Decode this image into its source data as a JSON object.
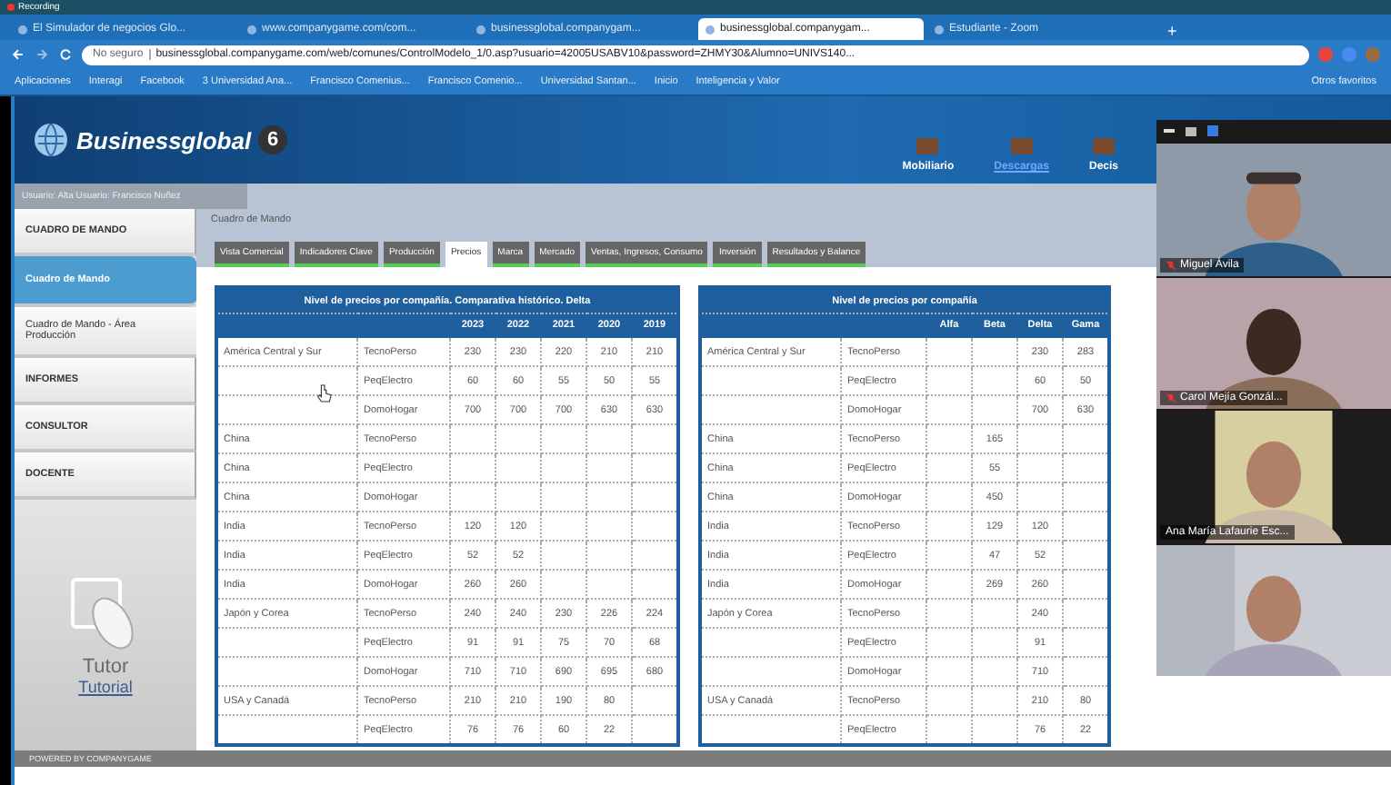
{
  "recording": {
    "label": "Recording"
  },
  "browser": {
    "tabs": [
      {
        "title": "El Simulador de negocios Glo...",
        "selected": false
      },
      {
        "title": "www.companygame.com/com...",
        "selected": false
      },
      {
        "title": "businessglobal.companygam...",
        "selected": false
      },
      {
        "title": "businessglobal.companygam...",
        "selected": true
      },
      {
        "title": "Estudiante - Zoom",
        "selected": false
      }
    ],
    "new_tab": "+",
    "address": {
      "security": "No seguro",
      "url": "businessglobal.companygame.com/web/comunes/ControlModelo_1/0.asp?usuario=42005USABV10&password=ZHMY30&Alumno=UNIVS140..."
    },
    "bookmarks": [
      "Aplicaciones",
      "Interagi",
      "Facebook",
      "3 Universidad Ana...",
      "Francisco Comenius...",
      "Francisco Comenio...",
      "Universidad Santan...",
      "Inicio",
      "Inteligencia y Valor"
    ],
    "other_bookmarks": "Otros favoritos"
  },
  "site": {
    "logo": "Businessglobal",
    "edition": "6",
    "nav": [
      {
        "label": "Mobiliario",
        "selected": false
      },
      {
        "label": "Descargas",
        "selected": true
      },
      {
        "label": "Decis",
        "selected": false
      }
    ],
    "user_strip": "Usuario: Alta  Usuario: Francisco Nuñez",
    "sidebar": {
      "items": [
        {
          "label": "CUADRO DE MANDO",
          "kind": "section",
          "selected": false
        },
        {
          "label": "Cuadro de Mando",
          "kind": "sub",
          "selected": true
        },
        {
          "label": "Cuadro de Mando - Área Producción",
          "kind": "sub",
          "selected": false
        },
        {
          "label": "INFORMES",
          "kind": "section",
          "selected": false
        },
        {
          "label": "CONSULTOR",
          "kind": "section",
          "selected": false
        },
        {
          "label": "DOCENTE",
          "kind": "section",
          "selected": false
        }
      ],
      "tutor": {
        "title": "Tutor",
        "link": "Tutorial"
      }
    },
    "breadcrumb": "Cuadro de Mando",
    "tabs": [
      {
        "label": "Vista Comercial",
        "selected": false
      },
      {
        "label": "Indicadores Clave",
        "selected": false
      },
      {
        "label": "Producción",
        "selected": false
      },
      {
        "label": "Precios",
        "selected": true
      },
      {
        "label": "Marca",
        "selected": false
      },
      {
        "label": "Mercado",
        "selected": false
      },
      {
        "label": "Ventas, Ingresos, Consumo",
        "selected": false
      },
      {
        "label": "Inversión",
        "selected": false
      },
      {
        "label": "Resultados y Balance",
        "selected": false
      }
    ],
    "tables": [
      {
        "title": "Nivel de precios por compañía. Comparativa histórico. Delta",
        "columns": [
          "2023",
          "2022",
          "2021",
          "2020",
          "2019"
        ],
        "rows": [
          {
            "region": "América Central y Sur",
            "company": "TecnoPerso",
            "cells": [
              {
                "text": "230"
              },
              {
                "text": "230"
              },
              {
                "text": "220"
              },
              {
                "text": "210"
              },
              {
                "text": "210"
              }
            ]
          },
          {
            "company": "PeqElectro",
            "cells": [
              {
                "text": "60"
              },
              {
                "text": "60"
              },
              {
                "text": "55"
              },
              {
                "text": "50"
              },
              {
                "text": "55"
              }
            ]
          },
          {
            "company": "DomoHogar",
            "cells": [
              {
                "text": "700"
              },
              {
                "text": "700"
              },
              {
                "text": "700"
              },
              {
                "text": "630"
              },
              {
                "text": "630"
              }
            ]
          },
          {
            "region": "China",
            "company": "TecnoPerso",
            "cells": [
              {
                "blank": true
              },
              {
                "blank": true
              },
              {
                "blank": true
              },
              {
                "blank": true
              },
              {
                "blank": true
              }
            ]
          },
          {
            "region": "China",
            "company": "PeqElectro",
            "cells": [
              {
                "blank": true
              },
              {
                "blank": true
              },
              {
                "blank": true
              },
              {
                "blank": true
              },
              {
                "blank": true
              }
            ]
          },
          {
            "region": "China",
            "company": "DomoHogar",
            "cells": [
              {
                "blank": true
              },
              {
                "blank": true
              },
              {
                "blank": true
              },
              {
                "blank": true
              },
              {
                "blank": true
              }
            ]
          },
          {
            "region": "India",
            "company": "TecnoPerso",
            "cells": [
              {
                "text": "120"
              },
              {
                "text": "120"
              },
              {
                "blank": true
              },
              {
                "blank": true
              },
              {
                "blank": true
              }
            ]
          },
          {
            "region": "India",
            "company": "PeqElectro",
            "cells": [
              {
                "text": "52"
              },
              {
                "text": "52"
              },
              {
                "blank": true
              },
              {
                "blank": true
              },
              {
                "blank": true
              }
            ]
          },
          {
            "region": "India",
            "company": "DomoHogar",
            "cells": [
              {
                "text": "260"
              },
              {
                "text": "260"
              },
              {
                "blank": true
              },
              {
                "blank": true
              },
              {
                "blank": true
              }
            ]
          },
          {
            "region": "Japón y Corea",
            "company": "TecnoPerso",
            "cells": [
              {
                "text": "240"
              },
              {
                "text": "240"
              },
              {
                "text": "230"
              },
              {
                "text": "226"
              },
              {
                "text": "224"
              }
            ]
          },
          {
            "company": "PeqElectro",
            "cells": [
              {
                "text": "91"
              },
              {
                "text": "91"
              },
              {
                "text": "75"
              },
              {
                "text": "70"
              },
              {
                "text": "68"
              }
            ]
          },
          {
            "company": "DomoHogar",
            "cells": [
              {
                "text": "710"
              },
              {
                "text": "710"
              },
              {
                "text": "690"
              },
              {
                "text": "695"
              },
              {
                "text": "680"
              }
            ]
          },
          {
            "region": "USA y Canadá",
            "company": "TecnoPerso",
            "cells": [
              {
                "text": "210"
              },
              {
                "text": "210"
              },
              {
                "text": "190"
              },
              {
                "text": "80"
              },
              {
                "blank": true
              }
            ]
          },
          {
            "company": "PeqElectro",
            "cells": [
              {
                "text": "76"
              },
              {
                "text": "76"
              },
              {
                "text": "60"
              },
              {
                "text": "22"
              },
              {
                "blank": true
              }
            ]
          }
        ]
      },
      {
        "title": "Nivel de precios por compañía",
        "columns": [
          "Alfa",
          "Beta",
          "Delta",
          "Gama"
        ],
        "rows": [
          {
            "region": "América Central y Sur",
            "company": "TecnoPerso",
            "cells": [
              {
                "blank": true
              },
              {
                "blank": true
              },
              {
                "text": "230"
              },
              {
                "text": "283"
              }
            ]
          },
          {
            "company": "PeqElectro",
            "cells": [
              {
                "blank": true
              },
              {
                "blank": true
              },
              {
                "text": "60"
              },
              {
                "text": "50"
              }
            ]
          },
          {
            "company": "DomoHogar",
            "cells": [
              {
                "blank": true
              },
              {
                "blank": true
              },
              {
                "text": "700"
              },
              {
                "text": "630"
              }
            ]
          },
          {
            "region": "China",
            "company": "TecnoPerso",
            "cells": [
              {
                "blank": true
              },
              {
                "text": "165"
              },
              {
                "blank": true
              },
              {
                "blank": true
              }
            ]
          },
          {
            "region": "China",
            "company": "PeqElectro",
            "cells": [
              {
                "blank": true
              },
              {
                "text": "55"
              },
              {
                "blank": true
              },
              {
                "blank": true
              }
            ]
          },
          {
            "region": "China",
            "company": "DomoHogar",
            "cells": [
              {
                "blank": true
              },
              {
                "text": "450"
              },
              {
                "blank": true
              },
              {
                "blank": true
              }
            ]
          },
          {
            "region": "India",
            "company": "TecnoPerso",
            "cells": [
              {
                "blank": true
              },
              {
                "text": "129"
              },
              {
                "text": "120"
              },
              {
                "blank": true
              }
            ]
          },
          {
            "region": "India",
            "company": "PeqElectro",
            "cells": [
              {
                "blank": true
              },
              {
                "text": "47"
              },
              {
                "text": "52"
              },
              {
                "blank": true
              }
            ]
          },
          {
            "region": "India",
            "company": "DomoHogar",
            "cells": [
              {
                "blank": true
              },
              {
                "text": "269"
              },
              {
                "text": "260"
              },
              {
                "blank": true
              }
            ]
          },
          {
            "region": "Japón y Corea",
            "company": "TecnoPerso",
            "cells": [
              {
                "blank": true
              },
              {
                "blank": true
              },
              {
                "text": "240"
              },
              {
                "blank": true
              }
            ]
          },
          {
            "company": "PeqElectro",
            "cells": [
              {
                "blank": true
              },
              {
                "blank": true
              },
              {
                "text": "91"
              },
              {
                "blank": true
              }
            ]
          },
          {
            "company": "DomoHogar",
            "cells": [
              {
                "blank": true
              },
              {
                "blank": true
              },
              {
                "text": "710"
              },
              {
                "blank": true
              }
            ]
          },
          {
            "region": "USA y Canadá",
            "company": "TecnoPerso",
            "cells": [
              {
                "blank": true
              },
              {
                "blank": true
              },
              {
                "text": "210"
              },
              {
                "text": "80"
              }
            ]
          },
          {
            "company": "PeqElectro",
            "cells": [
              {
                "blank": true
              },
              {
                "blank": true
              },
              {
                "text": "76"
              },
              {
                "text": "22"
              }
            ]
          }
        ]
      }
    ],
    "footer": "POWERED BY COMPANYGAME"
  },
  "meeting": {
    "participants": [
      {
        "name": "Miguel Ávila",
        "muted": true,
        "kind": "picture"
      },
      {
        "name": "Carol Mejía Gonzál...",
        "muted": true,
        "kind": "picture"
      },
      {
        "name": "Ana María Lafaurie Esc...",
        "muted": false,
        "kind": "picture"
      },
      {
        "kind": "picture"
      }
    ]
  }
}
